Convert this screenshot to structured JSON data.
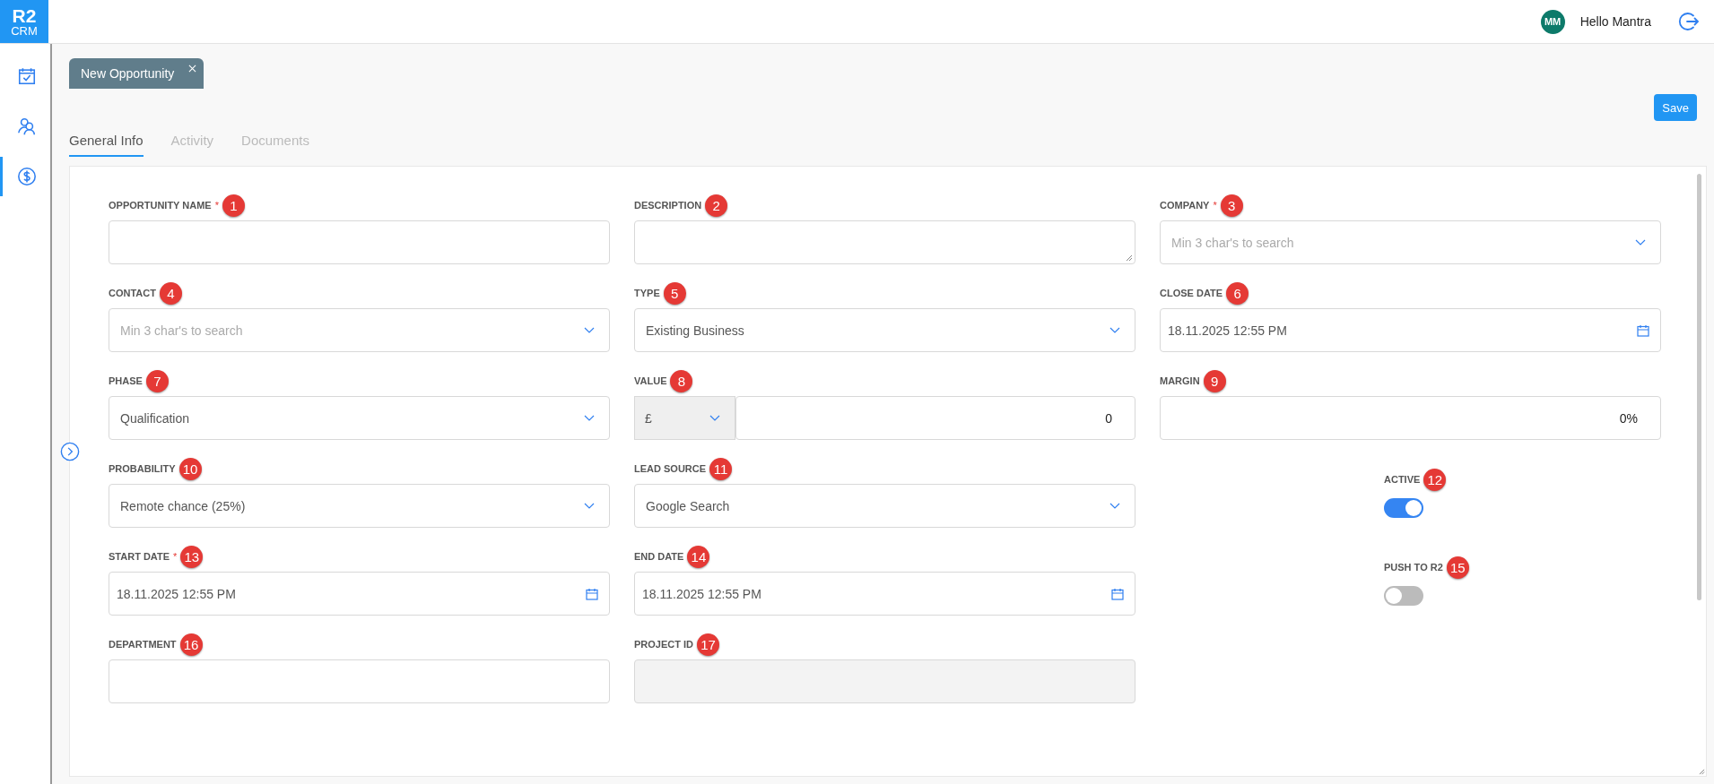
{
  "app": {
    "logo_top": "R2",
    "logo_bottom": "CRM"
  },
  "user": {
    "initials": "MM",
    "greeting": "Hello Mantra"
  },
  "sidebar": {
    "items": [
      {
        "kind": "calendar",
        "selected": false
      },
      {
        "kind": "contacts",
        "selected": false
      },
      {
        "kind": "dollar",
        "selected": true
      }
    ]
  },
  "open_tabs": [
    {
      "label": "New Opportunity",
      "selected": true
    }
  ],
  "save_button": "Save",
  "tabs": [
    {
      "label": "General Info",
      "selected": true
    },
    {
      "label": "Activity",
      "selected": false
    },
    {
      "label": "Documents",
      "selected": false
    }
  ],
  "fields": [
    {
      "kind": "text",
      "label": "OPPORTUNITY NAME",
      "required_mark": "*",
      "marker": "1"
    },
    {
      "kind": "textarea",
      "label": "DESCRIPTION",
      "marker": "2"
    },
    {
      "kind": "select",
      "label": "COMPANY",
      "required_mark": "*",
      "marker": "3",
      "placeholder": "Min 3 char's to search"
    },
    {
      "kind": "select",
      "label": "CONTACT",
      "marker": "4",
      "placeholder": "Min 3 char's to search"
    },
    {
      "kind": "select",
      "label": "TYPE",
      "marker": "5",
      "value": "Existing Business"
    },
    {
      "kind": "date",
      "label": "CLOSE DATE",
      "marker": "6",
      "value": "18.11.2025 12:55 PM"
    },
    {
      "kind": "select",
      "label": "PHASE",
      "marker": "7",
      "value": "Qualification"
    },
    {
      "kind": "currency",
      "label": "VALUE",
      "marker": "8",
      "currency": "£",
      "value": "0"
    },
    {
      "kind": "number",
      "label": "MARGIN",
      "marker": "9",
      "value": "0%"
    },
    {
      "kind": "select",
      "label": "PROBABILITY",
      "marker": "10",
      "value": "Remote chance (25%)"
    },
    {
      "kind": "select",
      "label": "LEAD SOURCE",
      "marker": "11",
      "value": "Google Search"
    },
    {
      "kind": "toggle",
      "label": "ACTIVE",
      "marker": "12",
      "on": true
    },
    {
      "kind": "date",
      "label": "START DATE",
      "required_mark": "*",
      "marker": "13",
      "value": "18.11.2025 12:55 PM"
    },
    {
      "kind": "date",
      "label": "END DATE",
      "marker": "14",
      "value": "18.11.2025 12:55 PM"
    },
    {
      "kind": "toggle",
      "label": "PUSH TO R2",
      "marker": "15",
      "on": false
    },
    {
      "kind": "text",
      "label": "DEPARTMENT",
      "marker": "16"
    },
    {
      "kind": "readonly",
      "label": "PROJECT ID",
      "marker": "17"
    }
  ]
}
